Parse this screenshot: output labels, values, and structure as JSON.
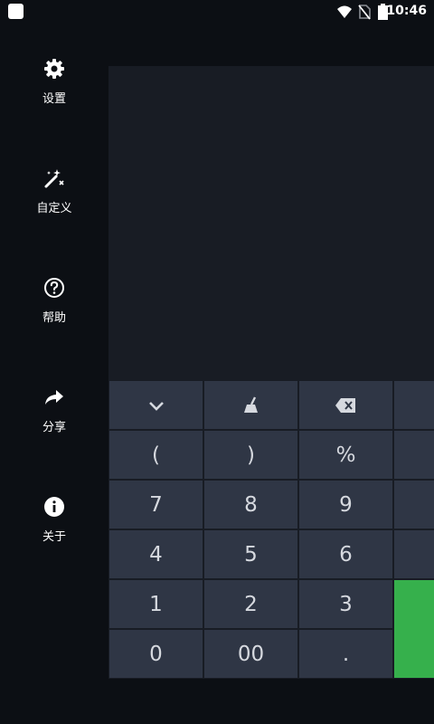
{
  "status_bar": {
    "time": "10:46"
  },
  "sidebar": {
    "items": [
      {
        "label": "设置",
        "icon": "gear-icon"
      },
      {
        "label": "自定义",
        "icon": "magic-wand-icon"
      },
      {
        "label": "帮助",
        "icon": "help-circle-icon"
      },
      {
        "label": "分享",
        "icon": "share-arrow-icon"
      },
      {
        "label": "关于",
        "icon": "info-circle-icon"
      }
    ]
  },
  "keypad": {
    "row1": {
      "collapse_icon": "chevron-down-icon",
      "clear_icon": "broom-icon",
      "backspace_icon": "backspace-icon"
    },
    "row2": [
      "(",
      ")",
      "%"
    ],
    "row3": [
      "7",
      "8",
      "9"
    ],
    "row4": [
      "4",
      "5",
      "6"
    ],
    "row5": [
      "1",
      "2",
      "3"
    ],
    "row6": [
      "0",
      "00",
      "."
    ]
  },
  "colors": {
    "background": "#0c0f14",
    "panel": "#181c24",
    "key": "#2f3645",
    "accent_green": "#36b04c"
  }
}
